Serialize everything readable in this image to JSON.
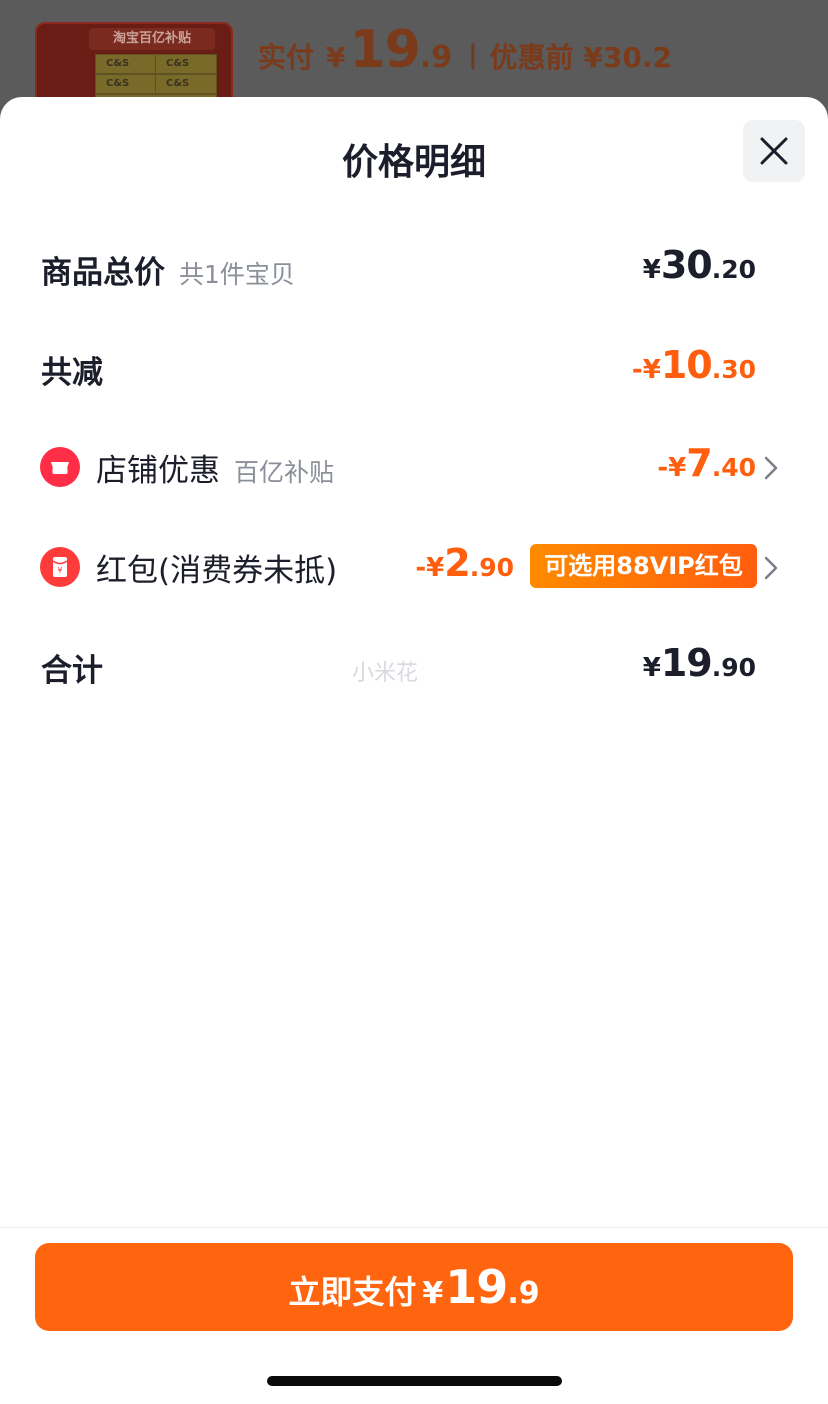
{
  "header": {
    "thumb_banner": "淘宝百亿补贴",
    "thumb_brand": "C&S",
    "paid_label": "实付",
    "paid_symbol": "¥",
    "paid_int": "19",
    "paid_dec": ".9",
    "separator": "|",
    "original_label": "优惠前 ¥30.2"
  },
  "sheet": {
    "title": "价格明细",
    "close_icon": "close-icon"
  },
  "rows": {
    "total": {
      "label": "商品总价",
      "sub": "共1件宝贝",
      "sym": "¥",
      "int": "30",
      "dec": ".20"
    },
    "discount": {
      "label": "共减",
      "sym": "-¥",
      "int": "10",
      "dec": ".30"
    },
    "store": {
      "icon": "store-icon",
      "label": "店铺优惠",
      "sub": "百亿补贴",
      "sym": "-¥",
      "int": "7",
      "dec": ".40"
    },
    "redpacket": {
      "icon": "red-packet-icon",
      "label": "红包(消费券未抵)",
      "sym": "-¥",
      "int": "2",
      "dec": ".90",
      "tag": "可选用88VIP红包"
    },
    "sum": {
      "label": "合计",
      "sym": "¥",
      "int": "19",
      "dec": ".90"
    }
  },
  "watermark": "小米花",
  "footer": {
    "pay_label": "立即支付",
    "pay_sym": "¥",
    "pay_int": "19",
    "pay_dec": ".9"
  },
  "colors": {
    "accent": "#ff650f",
    "discount_text": "#ff5e0e",
    "primary_text": "#1c1f2b",
    "secondary_text": "#8a8f99",
    "store_icon": "#ff2d46"
  }
}
